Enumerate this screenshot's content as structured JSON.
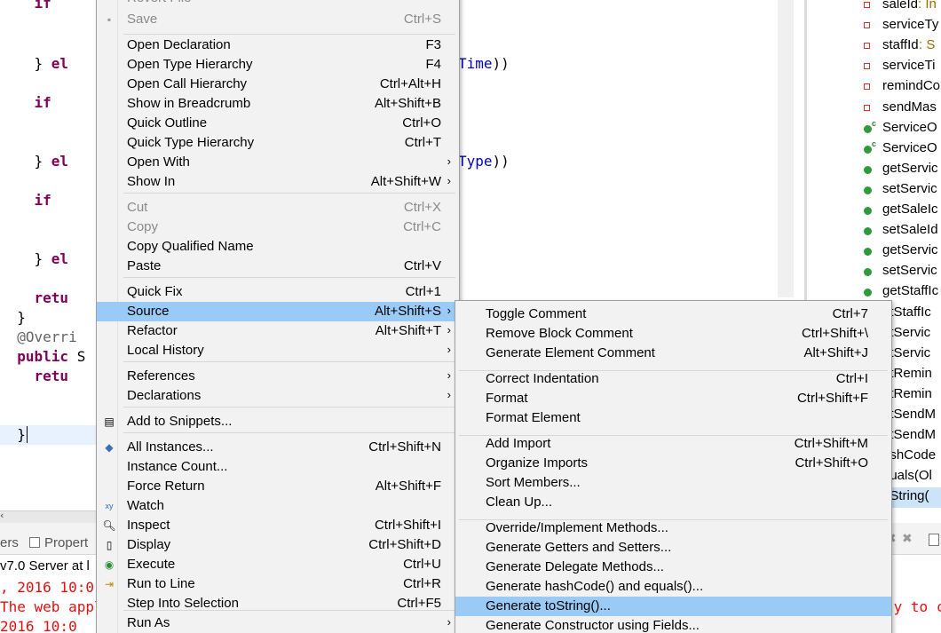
{
  "editor": {
    "lines": [
      {
        "text": "    if ",
        "kw": "if"
      },
      {
        "text": "    } el",
        "suffix": "Time))"
      },
      {
        "text": "    if "
      },
      {
        "text": "    } el",
        "suffix": "Type))"
      },
      {
        "text": "    if "
      },
      {
        "text": "    } el"
      },
      {
        "text": "    retu"
      },
      {
        "text": "}"
      },
      {
        "text": "@Overri"
      },
      {
        "text": "public S"
      },
      {
        "text": "    retu"
      },
      {
        "text": "}"
      },
      {
        "text": "}"
      }
    ],
    "suffix_time": "Time))",
    "suffix_type": "Type))"
  },
  "outline": {
    "items": [
      {
        "label": "saleId",
        "type": " : In",
        "icon": "field-private-icon"
      },
      {
        "label": "serviceTy",
        "type": "",
        "icon": "field-private-icon"
      },
      {
        "label": "staffId",
        "type": " : S",
        "icon": "field-private-icon"
      },
      {
        "label": "serviceTi",
        "type": "",
        "icon": "field-private-icon"
      },
      {
        "label": "remindCo",
        "type": "",
        "icon": "field-private-icon"
      },
      {
        "label": "sendMas",
        "type": "",
        "icon": "field-private-icon"
      },
      {
        "label": "ServiceO",
        "type": "",
        "icon": "constructor-icon"
      },
      {
        "label": "ServiceO",
        "type": "",
        "icon": "constructor-icon"
      },
      {
        "label": "getServic",
        "type": "",
        "icon": "method-public-icon"
      },
      {
        "label": "setServic",
        "type": "",
        "icon": "method-public-icon"
      },
      {
        "label": "getSaleIc",
        "type": "",
        "icon": "method-public-icon"
      },
      {
        "label": "setSaleId",
        "type": "",
        "icon": "method-public-icon"
      },
      {
        "label": "getServic",
        "type": "",
        "icon": "method-public-icon"
      },
      {
        "label": "setServic",
        "type": "",
        "icon": "method-public-icon"
      },
      {
        "label": "getStaffIc",
        "type": "",
        "icon": "method-public-icon"
      },
      {
        "label": "etStaffIc",
        "type": "",
        "icon": "method-public-icon"
      },
      {
        "label": "etServic",
        "type": "",
        "icon": "method-public-icon"
      },
      {
        "label": "etServic",
        "type": "",
        "icon": "method-public-icon"
      },
      {
        "label": "etRemin",
        "type": "",
        "icon": "method-public-icon"
      },
      {
        "label": "etRemin",
        "type": "",
        "icon": "method-public-icon"
      },
      {
        "label": "etSendM",
        "type": "",
        "icon": "method-public-icon"
      },
      {
        "label": "etSendM",
        "type": "",
        "icon": "method-public-icon"
      },
      {
        "label": "ashCode",
        "type": "",
        "icon": "method-public-icon"
      },
      {
        "label": "quals(Ol",
        "type": "",
        "icon": "method-public-icon"
      },
      {
        "label": "oString(",
        "type": "",
        "icon": "method-public-icon"
      }
    ]
  },
  "bottom": {
    "tab_servers": "ers",
    "tab_properties": "Propert",
    "server_line": "v7.0 Server at l",
    "log_line1": ", 2016 10:0",
    "log_line2": "The web appl",
    "log_line3": "2016 10:0",
    "right_log": "ly to c"
  },
  "context_menu": {
    "items": [
      {
        "label": "Revert File",
        "accel": "",
        "disabled": true
      },
      {
        "label": "Save",
        "accel": "Ctrl+S",
        "disabled": true
      },
      {
        "label": "Open Declaration",
        "accel": "F3"
      },
      {
        "label": "Open Type Hierarchy",
        "accel": "F4"
      },
      {
        "label": "Open Call Hierarchy",
        "accel": "Ctrl+Alt+H"
      },
      {
        "label": "Show in Breadcrumb",
        "accel": "Alt+Shift+B"
      },
      {
        "label": "Quick Outline",
        "accel": "Ctrl+O"
      },
      {
        "label": "Quick Type Hierarchy",
        "accel": "Ctrl+T"
      },
      {
        "label": "Open With",
        "accel": ""
      },
      {
        "label": "Show In",
        "accel": "Alt+Shift+W"
      },
      {
        "label": "Cut",
        "accel": "Ctrl+X",
        "disabled": true
      },
      {
        "label": "Copy",
        "accel": "Ctrl+C",
        "disabled": true
      },
      {
        "label": "Copy Qualified Name",
        "accel": ""
      },
      {
        "label": "Paste",
        "accel": "Ctrl+V"
      },
      {
        "label": "Quick Fix",
        "accel": "Ctrl+1"
      },
      {
        "label": "Source",
        "accel": "Alt+Shift+S"
      },
      {
        "label": "Refactor",
        "accel": "Alt+Shift+T"
      },
      {
        "label": "Local History",
        "accel": ""
      },
      {
        "label": "References",
        "accel": ""
      },
      {
        "label": "Declarations",
        "accel": ""
      },
      {
        "label": "Add to Snippets...",
        "accel": ""
      },
      {
        "label": "All Instances...",
        "accel": "Ctrl+Shift+N"
      },
      {
        "label": "Instance Count...",
        "accel": ""
      },
      {
        "label": "Force Return",
        "accel": "Alt+Shift+F"
      },
      {
        "label": "Watch",
        "accel": ""
      },
      {
        "label": "Inspect",
        "accel": "Ctrl+Shift+I"
      },
      {
        "label": "Display",
        "accel": "Ctrl+Shift+D"
      },
      {
        "label": "Execute",
        "accel": "Ctrl+U"
      },
      {
        "label": "Run to Line",
        "accel": "Ctrl+R"
      },
      {
        "label": "Step Into Selection",
        "accel": "Ctrl+F5"
      },
      {
        "label": "Run As",
        "accel": ""
      }
    ]
  },
  "source_submenu": {
    "items": [
      {
        "label": "Toggle Comment",
        "accel": "Ctrl+7"
      },
      {
        "label": "Remove Block Comment",
        "accel": "Ctrl+Shift+\\"
      },
      {
        "label": "Generate Element Comment",
        "accel": "Alt+Shift+J"
      },
      {
        "label": "Correct Indentation",
        "accel": "Ctrl+I"
      },
      {
        "label": "Format",
        "accel": "Ctrl+Shift+F"
      },
      {
        "label": "Format Element",
        "accel": ""
      },
      {
        "label": "Add Import",
        "accel": "Ctrl+Shift+M"
      },
      {
        "label": "Organize Imports",
        "accel": "Ctrl+Shift+O"
      },
      {
        "label": "Sort Members...",
        "accel": ""
      },
      {
        "label": "Clean Up...",
        "accel": ""
      },
      {
        "label": "Override/Implement Methods...",
        "accel": ""
      },
      {
        "label": "Generate Getters and Setters...",
        "accel": ""
      },
      {
        "label": "Generate Delegate Methods...",
        "accel": ""
      },
      {
        "label": "Generate hashCode() and equals()...",
        "accel": ""
      },
      {
        "label": "Generate toString()...",
        "accel": ""
      },
      {
        "label": "Generate Constructor using Fields...",
        "accel": ""
      }
    ]
  },
  "colors": {
    "highlight": "#99cbf6",
    "menu_bg": "#f2f2f2",
    "keyword": "#7f0055",
    "field": "#0000c0",
    "console_red": "#e01010"
  }
}
